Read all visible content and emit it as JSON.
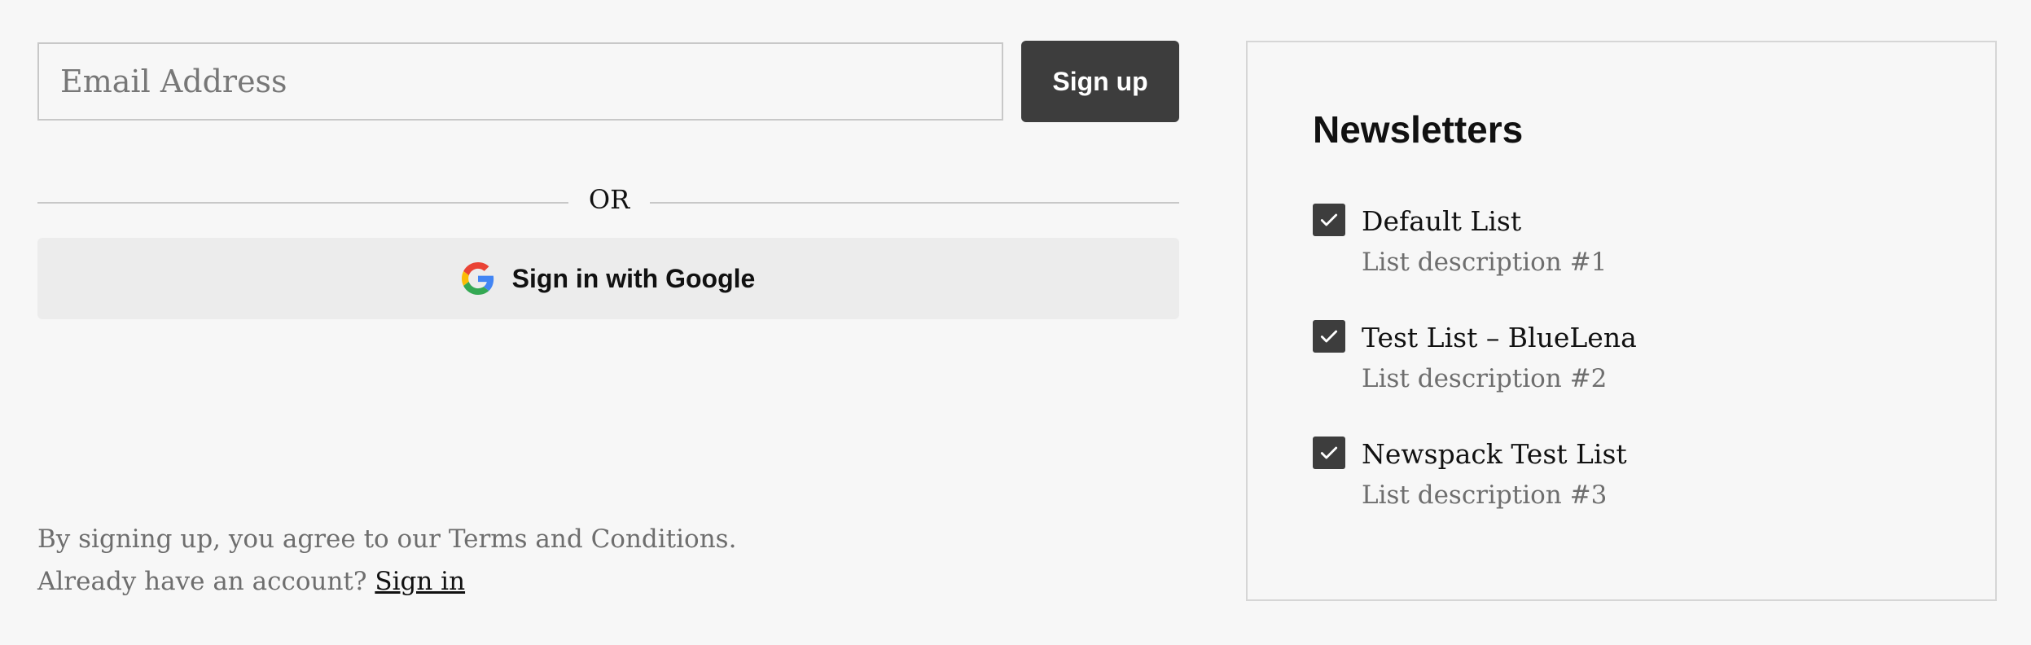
{
  "signup": {
    "email_placeholder": "Email Address",
    "email_value": "",
    "signup_label": "Sign up",
    "or_label": "OR",
    "google_label": "Sign in with Google",
    "google_icon": "google-g-icon"
  },
  "footer": {
    "terms_text": "By signing up, you agree to our Terms and Conditions.",
    "account_prompt": "Already have an account?",
    "signin_link": "Sign in"
  },
  "newsletters": {
    "title": "Newsletters",
    "items": [
      {
        "name": "Default List",
        "description": "List description #1",
        "checked": true
      },
      {
        "name": "Test List – BlueLena",
        "description": "List description #2",
        "checked": true
      },
      {
        "name": "Newspack Test List",
        "description": "List description #3",
        "checked": true
      }
    ]
  },
  "colors": {
    "page_background": "#f7f7f7",
    "button_dark": "#3d3d3d",
    "google_button_bg": "#ececec",
    "muted_text": "#6e6e6e",
    "border": "#c8c8c8"
  }
}
